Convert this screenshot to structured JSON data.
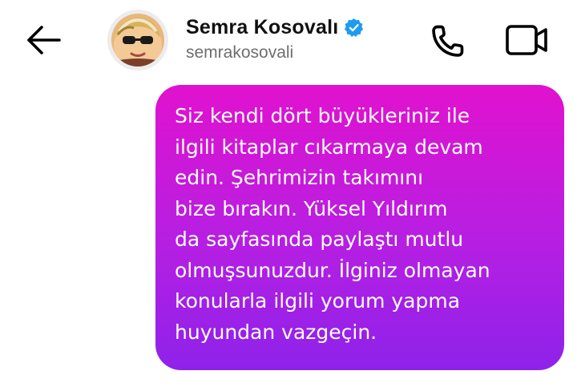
{
  "header": {
    "display_name": "Semra Kosovalı",
    "username": "semrakosovali",
    "verified": true
  },
  "icons": {
    "back": "back-arrow-icon",
    "verified": "verified-badge-icon",
    "call": "phone-icon",
    "video": "video-camera-icon"
  },
  "colors": {
    "bubble_gradient_top": "#e112cf",
    "bubble_gradient_bottom": "#8e22ea",
    "verified_blue": "#1d9bf0"
  },
  "messages": [
    {
      "direction": "outgoing",
      "text": "Siz kendi dört büyükleriniz ile\nilgili kitaplar cıkarmaya devam\nedin. Şehrimizin takımını\nbize bırakın. Yüksel Yıldırım\nda sayfasında paylaştı mutlu\nolmuşsunuzdur. İlginiz olmayan\nkonularla ilgili yorum yapma\nhuyundan vazgeçin."
    }
  ]
}
